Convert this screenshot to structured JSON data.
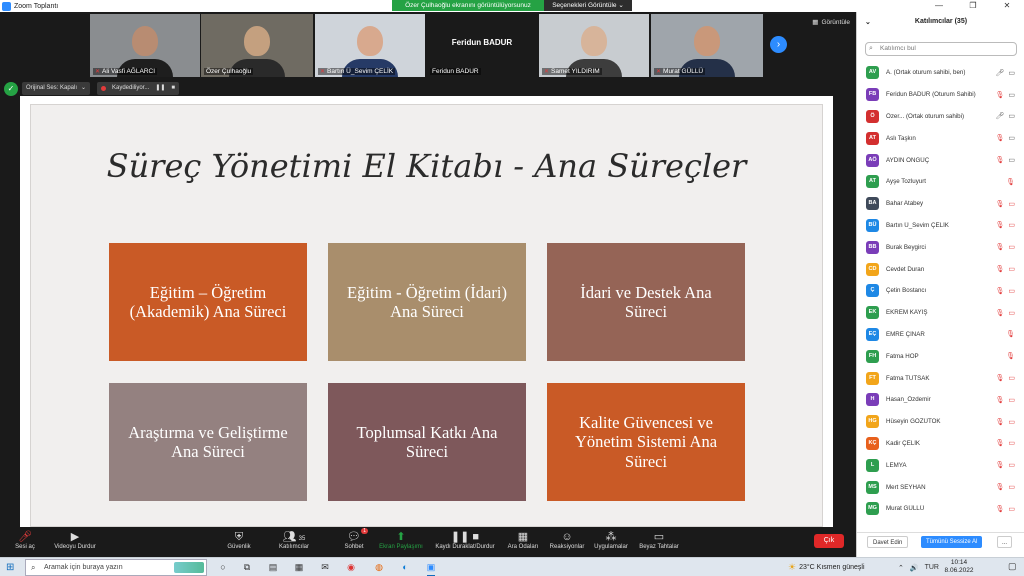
{
  "window": {
    "title": "Zoom Toplantı",
    "controls": [
      "—",
      "❐",
      "✕"
    ]
  },
  "share_banner": {
    "text": "Özer Çulhaoğlu ekranını görüntülüyorsunuz",
    "options_label": "Seçenekleri Görüntüle ⌄"
  },
  "video_strip": {
    "view_label": "Görüntüle",
    "tiles": [
      {
        "name": "Ali Vasfi AĞLARCI",
        "muted": true
      },
      {
        "name": "Özer Çulhaoğlu",
        "muted": false
      },
      {
        "name": "Bartın Ü_Sevim ÇELİK",
        "muted": true
      },
      {
        "name": "Feridun BADUR",
        "muted": false,
        "center_name": "Feridun BADUR"
      },
      {
        "name": "Samet YILDIRIM",
        "muted": true
      },
      {
        "name": "Murat GÜLLÜ",
        "muted": true
      }
    ]
  },
  "status": {
    "original_sound": "Orijinal Ses: Kapalı",
    "original_sound_arrow": "⌄",
    "recording": "Kaydediliyor...",
    "pause": "❚❚",
    "stop": "■"
  },
  "slide": {
    "title": "Süreç Yönetimi El Kitabı - Ana Süreçler",
    "boxes": [
      {
        "text": "Eğitim – Öğretim (Akademik) Ana Süreci",
        "color": "#c95a26"
      },
      {
        "text": "Eğitim - Öğretim (İdari) Ana Süreci",
        "color": "#a98e6c"
      },
      {
        "text": "İdari ve Destek Ana Süreci",
        "color": "#956456"
      },
      {
        "text": "Araştırma ve Geliştirme Ana Süreci",
        "color": "#948180"
      },
      {
        "text": "Toplumsal Katkı Ana Süreci",
        "color": "#7e585b"
      },
      {
        "text": "Kalite Güvencesi ve Yönetim Sistemi Ana Süreci",
        "color": "#c95a26"
      }
    ]
  },
  "toolbar": {
    "audio": "Sesi aç",
    "video": "Videoyu Durdur",
    "security": "Güvenlik",
    "participants": "Katılımcılar",
    "participants_count": "35",
    "chat": "Sohbet",
    "chat_badge": "1",
    "share": "Ekran Paylaşımı",
    "record": "Kaydı Duraklat/Durdur",
    "rooms": "Ara Odaları",
    "reactions": "Reaksiyonlar",
    "apps": "Uygulamalar",
    "whiteboard": "Beyaz Tahtalar",
    "leave": "Çık"
  },
  "panel": {
    "title": "Katılımcılar (35)",
    "search_placeholder": "Katılımcı bul",
    "invite": "Davet Edin",
    "mute_all": "Tümünü Sessize Al",
    "more": "...",
    "participants": [
      {
        "initials": "AV",
        "name": "A. (Ortak oturum sahibi, ben)",
        "color": "#2e9e4f",
        "mic": "on",
        "cam": "on"
      },
      {
        "initials": "FB",
        "name": "Feridun BADUR (Oturum Sahibi)",
        "color": "#7a3db8",
        "mic": "off",
        "cam": "on"
      },
      {
        "initials": "Ö",
        "name": "Özer... (Ortak oturum sahibi)",
        "color": "#d32f2f",
        "mic": "on",
        "cam": "on"
      },
      {
        "initials": "AT",
        "name": "Aslı Taşkın",
        "color": "#d32f2f",
        "mic": "off",
        "cam": "on"
      },
      {
        "initials": "AÖ",
        "name": "AYDIN ÖNGÜÇ",
        "color": "#7a3db8",
        "mic": "off",
        "cam": "on"
      },
      {
        "initials": "AT",
        "name": "Ayşe Tozluyurt",
        "color": "#2e9e4f",
        "mic": "off",
        "cam": "none"
      },
      {
        "initials": "BA",
        "name": "Bahar Atabey",
        "color": "#3f4a5a",
        "mic": "off",
        "cam": "off"
      },
      {
        "initials": "BÜ",
        "name": "Bartın Ü_Sevim ÇELİK",
        "color": "#1e88e5",
        "mic": "off",
        "cam": "off"
      },
      {
        "initials": "BB",
        "name": "Burak Beygirci",
        "color": "#7a3db8",
        "mic": "off",
        "cam": "off"
      },
      {
        "initials": "CD",
        "name": "Cevdet Duran",
        "color": "#f2a51a",
        "mic": "off",
        "cam": "off"
      },
      {
        "initials": "Ç",
        "name": "Çetin Bostancı",
        "color": "#1e88e5",
        "mic": "off",
        "cam": "off"
      },
      {
        "initials": "EK",
        "name": "EKREM KAYIŞ",
        "color": "#2e9e4f",
        "mic": "off",
        "cam": "off"
      },
      {
        "initials": "EÇ",
        "name": "EMRE ÇINAR",
        "color": "#1e88e5",
        "mic": "off",
        "cam": "none"
      },
      {
        "initials": "FH",
        "name": "Fatma HOP",
        "color": "#2e9e4f",
        "mic": "off",
        "cam": "none"
      },
      {
        "initials": "FT",
        "name": "Fatma TUTSAK",
        "color": "#f2a51a",
        "mic": "off",
        "cam": "off"
      },
      {
        "initials": "H",
        "name": "Hasan_Özdemir",
        "color": "#7a3db8",
        "mic": "off",
        "cam": "off"
      },
      {
        "initials": "HG",
        "name": "Hüseyin GÖZÜTOK",
        "color": "#f2a51a",
        "mic": "off",
        "cam": "off"
      },
      {
        "initials": "KÇ",
        "name": "Kadir ÇELİK",
        "color": "#e8601c",
        "mic": "off",
        "cam": "off"
      },
      {
        "initials": "L",
        "name": "LEMYA",
        "color": "#2e9e4f",
        "mic": "off",
        "cam": "off"
      },
      {
        "initials": "MS",
        "name": "Mert SEYHAN",
        "color": "#2e9e4f",
        "mic": "off",
        "cam": "off"
      },
      {
        "initials": "MG",
        "name": "Murat GÜLLÜ",
        "color": "#2e9e4f",
        "mic": "off",
        "cam": "off"
      }
    ]
  },
  "taskbar": {
    "search_placeholder": "Aramak için buraya yazın",
    "weather": "23°C  Kısmen güneşli",
    "tray": [
      "⌃",
      "🔊",
      "TUR"
    ],
    "time": "10:14",
    "date": "8.06.2022"
  }
}
